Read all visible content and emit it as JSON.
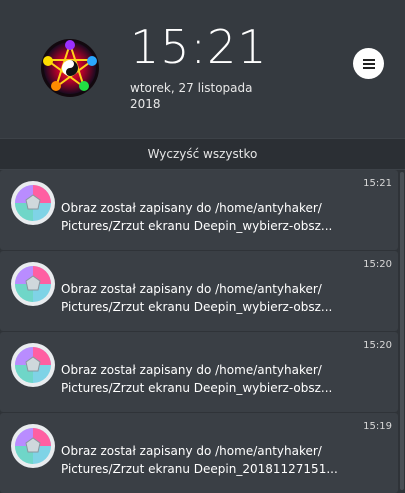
{
  "header": {
    "avatar_icon": "pentagram-chakra-avatar-icon",
    "time": "15:21",
    "date": "wtorek, 27 listopada 2018",
    "menu_icon": "hamburger-menu-icon"
  },
  "clear_all_label": "Wyczyść wszystko",
  "notifications": [
    {
      "time": "15:21",
      "line1": "Obraz został zapisany do /home/antyhaker/",
      "line2": "Pictures/Zrzut ekranu Deepin_wybierz-obsz...",
      "icon": "deepin-screenshot-app-icon"
    },
    {
      "time": "15:20",
      "line1": "Obraz został zapisany do /home/antyhaker/",
      "line2": "Pictures/Zrzut ekranu Deepin_wybierz-obsz...",
      "icon": "deepin-screenshot-app-icon"
    },
    {
      "time": "15:20",
      "line1": "Obraz został zapisany do /home/antyhaker/",
      "line2": "Pictures/Zrzut ekranu Deepin_wybierz-obsz...",
      "icon": "deepin-screenshot-app-icon"
    },
    {
      "time": "15:19",
      "line1": "Obraz został zapisany do /home/antyhaker/",
      "line2": "Pictures/Zrzut ekranu Deepin_20181127151...",
      "icon": "deepin-screenshot-app-icon"
    }
  ],
  "colors": {
    "background": "#2f3338",
    "header": "#353a40",
    "card": "#3a3f45"
  }
}
